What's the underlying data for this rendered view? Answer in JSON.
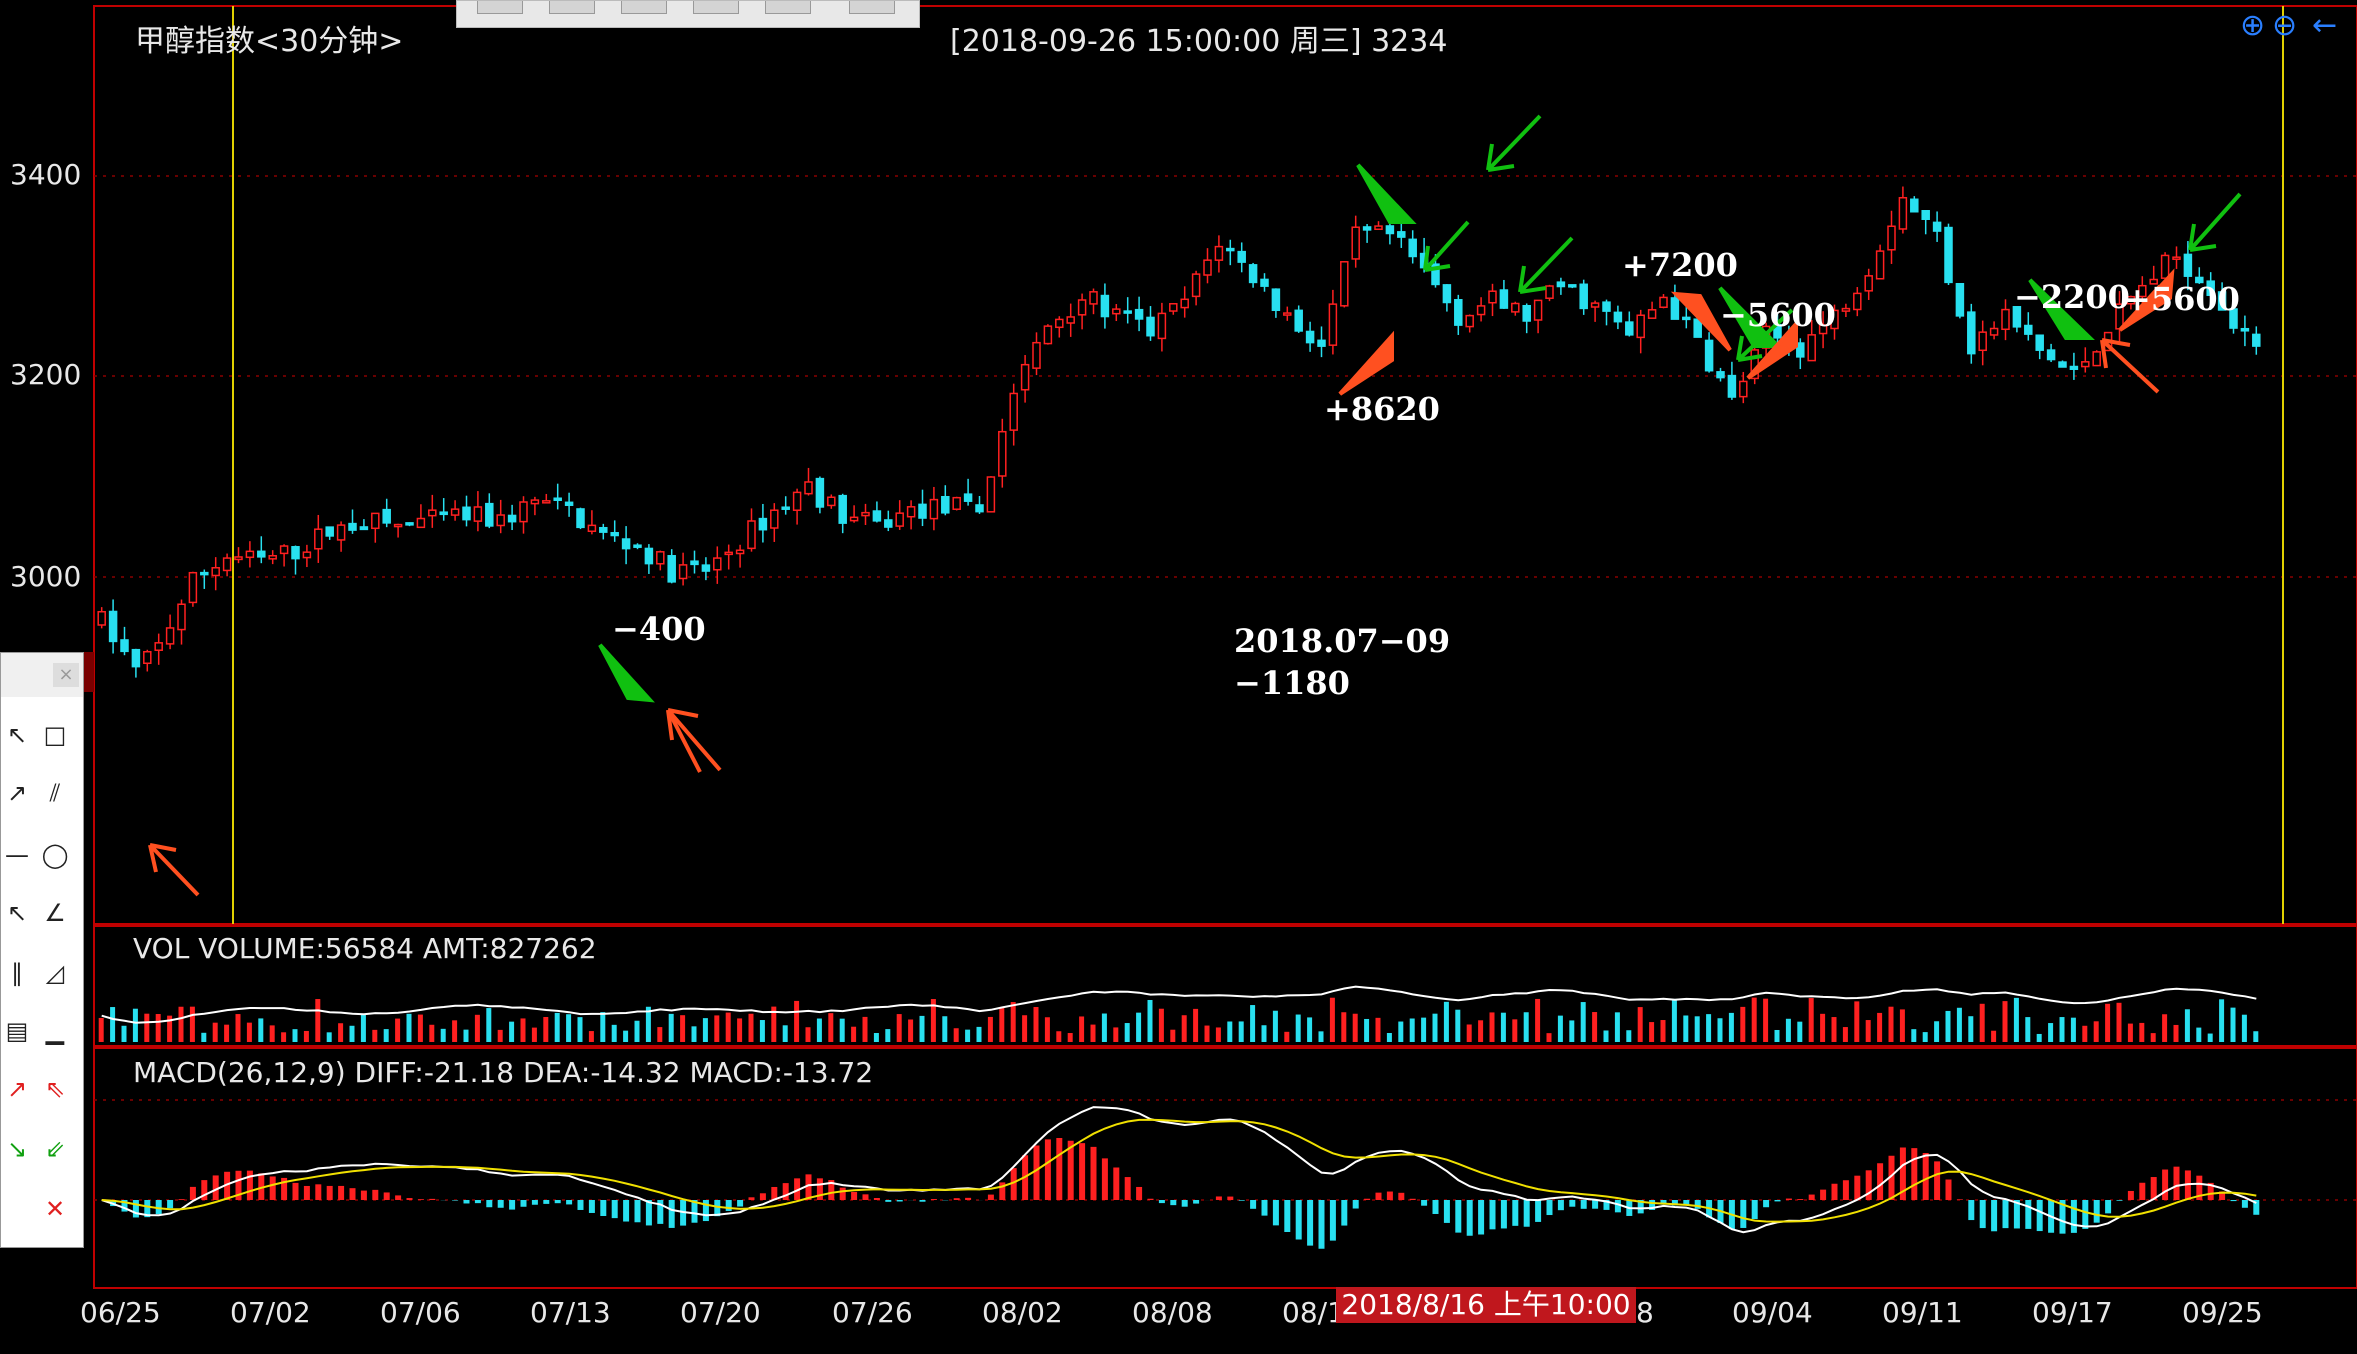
{
  "window": {
    "title": "甲醇指数<30分钟>",
    "status": "[2018-09-26  15:00:00 周三]   3234"
  },
  "y_axis": {
    "labels": [
      "3400",
      "3200",
      "3000"
    ]
  },
  "x_axis": {
    "labels": [
      "06/25",
      "07/02",
      "07/06",
      "07/13",
      "07/20",
      "07/26",
      "08/02",
      "08/08",
      "08/1",
      "8",
      "09/04",
      "09/11",
      "09/17",
      "09/25"
    ]
  },
  "volume_panel": {
    "info": "VOL  VOLUME:56584 AMT:827262"
  },
  "macd_panel": {
    "info": "MACD(26,12,9)  DIFF:-21.18 DEA:-14.32 MACD:-13.72"
  },
  "cursor_date": "2018/8/16 上午10:00",
  "annotations": [
    {
      "text": "−400"
    },
    {
      "text": "+8620"
    },
    {
      "text": "+7200"
    },
    {
      "text": "−5600"
    },
    {
      "text": "−2200"
    },
    {
      "text": "+5600"
    }
  ],
  "note": {
    "line1": "2018.07−09",
    "line2": "−1180"
  },
  "toolbar": {
    "icons": [
      "zoom-in-icon",
      "zoom-out-icon",
      "arrow-left-icon"
    ]
  },
  "colors": {
    "up": "#ff2020",
    "down": "#28e0f0",
    "frame": "#c00000",
    "cursor_line": "#e0d000",
    "arrow_green": "#10c010",
    "arrow_orange": "#ff5020"
  },
  "chart_data": {
    "type": "candlestick",
    "title": "甲醇指数<30分钟>",
    "ylim": [
      2880,
      3500
    ],
    "y_ticks": [
      3000,
      3200,
      3400
    ],
    "x_tick_labels": [
      "06/25",
      "07/02",
      "07/06",
      "07/13",
      "07/20",
      "07/26",
      "08/02",
      "08/08",
      "08/1",
      "8",
      "09/04",
      "09/11",
      "09/17",
      "09/25"
    ],
    "price_path": [
      [
        0,
        2955
      ],
      [
        3,
        2905
      ],
      [
        5,
        2930
      ],
      [
        8,
        2995
      ],
      [
        11,
        3020
      ],
      [
        14,
        3015
      ],
      [
        17,
        3025
      ],
      [
        20,
        3045
      ],
      [
        23,
        3055
      ],
      [
        26,
        3050
      ],
      [
        29,
        3055
      ],
      [
        32,
        3060
      ],
      [
        35,
        3055
      ],
      [
        38,
        3075
      ],
      [
        41,
        3065
      ],
      [
        44,
        3040
      ],
      [
        47,
        3030
      ],
      [
        50,
        3005
      ],
      [
        53,
        3005
      ],
      [
        56,
        3035
      ],
      [
        59,
        3065
      ],
      [
        62,
        3090
      ],
      [
        65,
        3060
      ],
      [
        68,
        3050
      ],
      [
        71,
        3065
      ],
      [
        74,
        3070
      ],
      [
        77,
        3065
      ],
      [
        80,
        3185
      ],
      [
        83,
        3250
      ],
      [
        86,
        3280
      ],
      [
        89,
        3260
      ],
      [
        92,
        3245
      ],
      [
        95,
        3275
      ],
      [
        98,
        3335
      ],
      [
        101,
        3300
      ],
      [
        104,
        3260
      ],
      [
        107,
        3230
      ],
      [
        110,
        3340
      ],
      [
        113,
        3340
      ],
      [
        116,
        3305
      ],
      [
        119,
        3260
      ],
      [
        122,
        3275
      ],
      [
        125,
        3260
      ],
      [
        128,
        3290
      ],
      [
        131,
        3270
      ],
      [
        134,
        3240
      ],
      [
        137,
        3280
      ],
      [
        140,
        3235
      ],
      [
        143,
        3175
      ],
      [
        146,
        3240
      ],
      [
        149,
        3230
      ],
      [
        152,
        3260
      ],
      [
        155,
        3310
      ],
      [
        158,
        3380
      ],
      [
        161,
        3340
      ],
      [
        164,
        3230
      ],
      [
        167,
        3260
      ],
      [
        170,
        3225
      ],
      [
        173,
        3200
      ],
      [
        176,
        3250
      ],
      [
        179,
        3290
      ],
      [
        182,
        3320
      ],
      [
        185,
        3290
      ],
      [
        188,
        3235
      ]
    ],
    "annotations": [
      {
        "text": "−400",
        "date": "07/18"
      },
      {
        "text": "+8620",
        "date": "08/14"
      },
      {
        "text": "+7200",
        "date": "08/30"
      },
      {
        "text": "−5600",
        "date": "09/04"
      },
      {
        "text": "−2200",
        "date": "09/19"
      },
      {
        "text": "+5600",
        "date": "09/21"
      }
    ],
    "volume": {
      "VOLUME": 56584,
      "AMT": 827262
    },
    "macd": {
      "params": "26,12,9",
      "DIFF": -21.18,
      "DEA": -14.32,
      "MACD": -13.72
    }
  }
}
